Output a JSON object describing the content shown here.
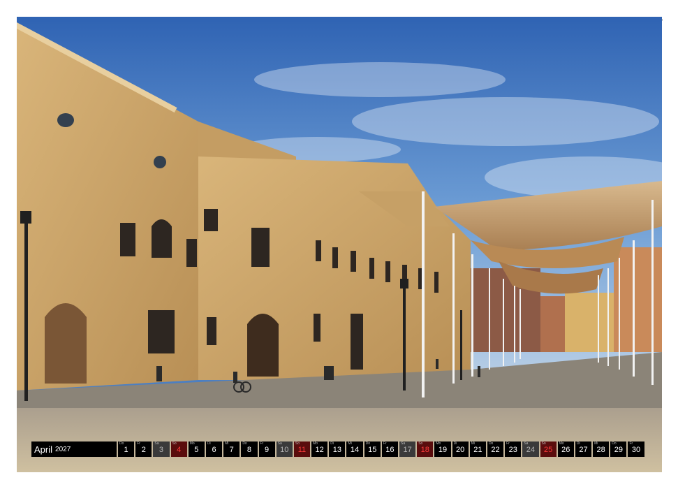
{
  "calendar": {
    "month": "April",
    "year": "2027",
    "days": [
      {
        "n": "1",
        "wd": "Do",
        "type": "normal"
      },
      {
        "n": "2",
        "wd": "Fr",
        "type": "normal"
      },
      {
        "n": "3",
        "wd": "Sa",
        "type": "weekend"
      },
      {
        "n": "4",
        "wd": "So",
        "type": "holiday"
      },
      {
        "n": "5",
        "wd": "Mo",
        "type": "normal"
      },
      {
        "n": "6",
        "wd": "Di",
        "type": "normal"
      },
      {
        "n": "7",
        "wd": "Mi",
        "type": "normal"
      },
      {
        "n": "8",
        "wd": "Do",
        "type": "normal"
      },
      {
        "n": "9",
        "wd": "Fr",
        "type": "normal"
      },
      {
        "n": "10",
        "wd": "Sa",
        "type": "weekend"
      },
      {
        "n": "11",
        "wd": "So",
        "type": "holiday"
      },
      {
        "n": "12",
        "wd": "Mo",
        "type": "normal"
      },
      {
        "n": "13",
        "wd": "Di",
        "type": "normal"
      },
      {
        "n": "14",
        "wd": "Mi",
        "type": "normal"
      },
      {
        "n": "15",
        "wd": "Do",
        "type": "normal"
      },
      {
        "n": "16",
        "wd": "Fr",
        "type": "normal"
      },
      {
        "n": "17",
        "wd": "Sa",
        "type": "weekend"
      },
      {
        "n": "18",
        "wd": "So",
        "type": "holiday"
      },
      {
        "n": "19",
        "wd": "Mo",
        "type": "normal"
      },
      {
        "n": "20",
        "wd": "Di",
        "type": "normal"
      },
      {
        "n": "21",
        "wd": "Mi",
        "type": "normal"
      },
      {
        "n": "22",
        "wd": "Do",
        "type": "normal"
      },
      {
        "n": "23",
        "wd": "Fr",
        "type": "normal"
      },
      {
        "n": "24",
        "wd": "Sa",
        "type": "weekend"
      },
      {
        "n": "25",
        "wd": "So",
        "type": "holiday"
      },
      {
        "n": "26",
        "wd": "Mo",
        "type": "normal"
      },
      {
        "n": "27",
        "wd": "Di",
        "type": "normal"
      },
      {
        "n": "28",
        "wd": "Mi",
        "type": "normal"
      },
      {
        "n": "29",
        "wd": "Do",
        "type": "normal"
      },
      {
        "n": "30",
        "wd": "Fr",
        "type": "normal"
      }
    ]
  },
  "colors": {
    "bar_background": "#000000",
    "weekend": "#3a3a3a",
    "holiday_text": "#ff3b3b",
    "sky": "#4c7fc2",
    "stone": "#c9a66b"
  }
}
